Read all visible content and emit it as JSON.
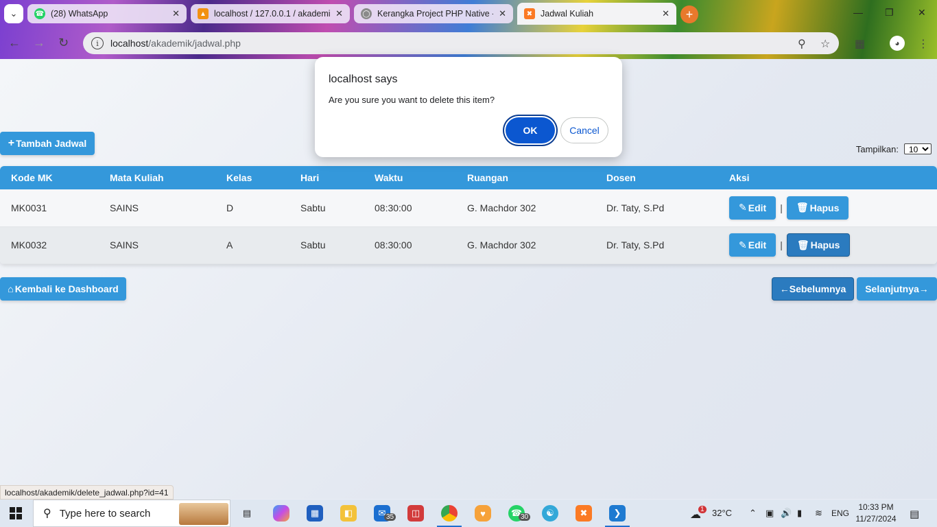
{
  "browser": {
    "tabs": [
      {
        "title": "(28) WhatsApp",
        "icon": "whatsapp-icon"
      },
      {
        "title": "localhost / 127.0.0.1 / akademik",
        "icon": "phpmyadmin-icon"
      },
      {
        "title": "Kerangka Project PHP Native - ",
        "icon": "globe-icon"
      },
      {
        "title": "Jadwal Kuliah",
        "icon": "xampp-icon"
      }
    ],
    "url_host": "localhost",
    "url_path": "/akademik/jadwal.php",
    "status_url": "localhost/akademik/delete_jadwal.php?id=41"
  },
  "dialog": {
    "title": "localhost says",
    "message": "Are you sure you want to delete this item?",
    "ok_label": "OK",
    "cancel_label": "Cancel"
  },
  "page": {
    "add_button": "Tambah Jadwal",
    "show_label": "Tampilkan:",
    "show_value": "10",
    "columns": [
      "Kode MK",
      "Mata Kuliah",
      "Kelas",
      "Hari",
      "Waktu",
      "Ruangan",
      "Dosen",
      "Aksi"
    ],
    "rows": [
      {
        "kode": "MK0031",
        "mk": "SAINS",
        "kelas": "D",
        "hari": "Sabtu",
        "waktu": "08:30:00",
        "ruangan": "G. Machdor 302",
        "dosen": "Dr. Taty, S.Pd"
      },
      {
        "kode": "MK0032",
        "mk": "SAINS",
        "kelas": "A",
        "hari": "Sabtu",
        "waktu": "08:30:00",
        "ruangan": "G. Machdor 302",
        "dosen": "Dr. Taty, S.Pd"
      }
    ],
    "edit_label": "Edit",
    "delete_label": "Hapus",
    "separator": "|",
    "back_button": "Kembali ke Dashboard",
    "prev_button": "Sebelumnya",
    "next_button": "Selanjutnya"
  },
  "taskbar": {
    "search_placeholder": "Type here to search",
    "mail_badge": "35",
    "whatsapp_badge": "30",
    "weather_badge": "1",
    "temperature": "32°C",
    "language": "ENG",
    "time": "10:33 PM",
    "date": "11/27/2024"
  }
}
